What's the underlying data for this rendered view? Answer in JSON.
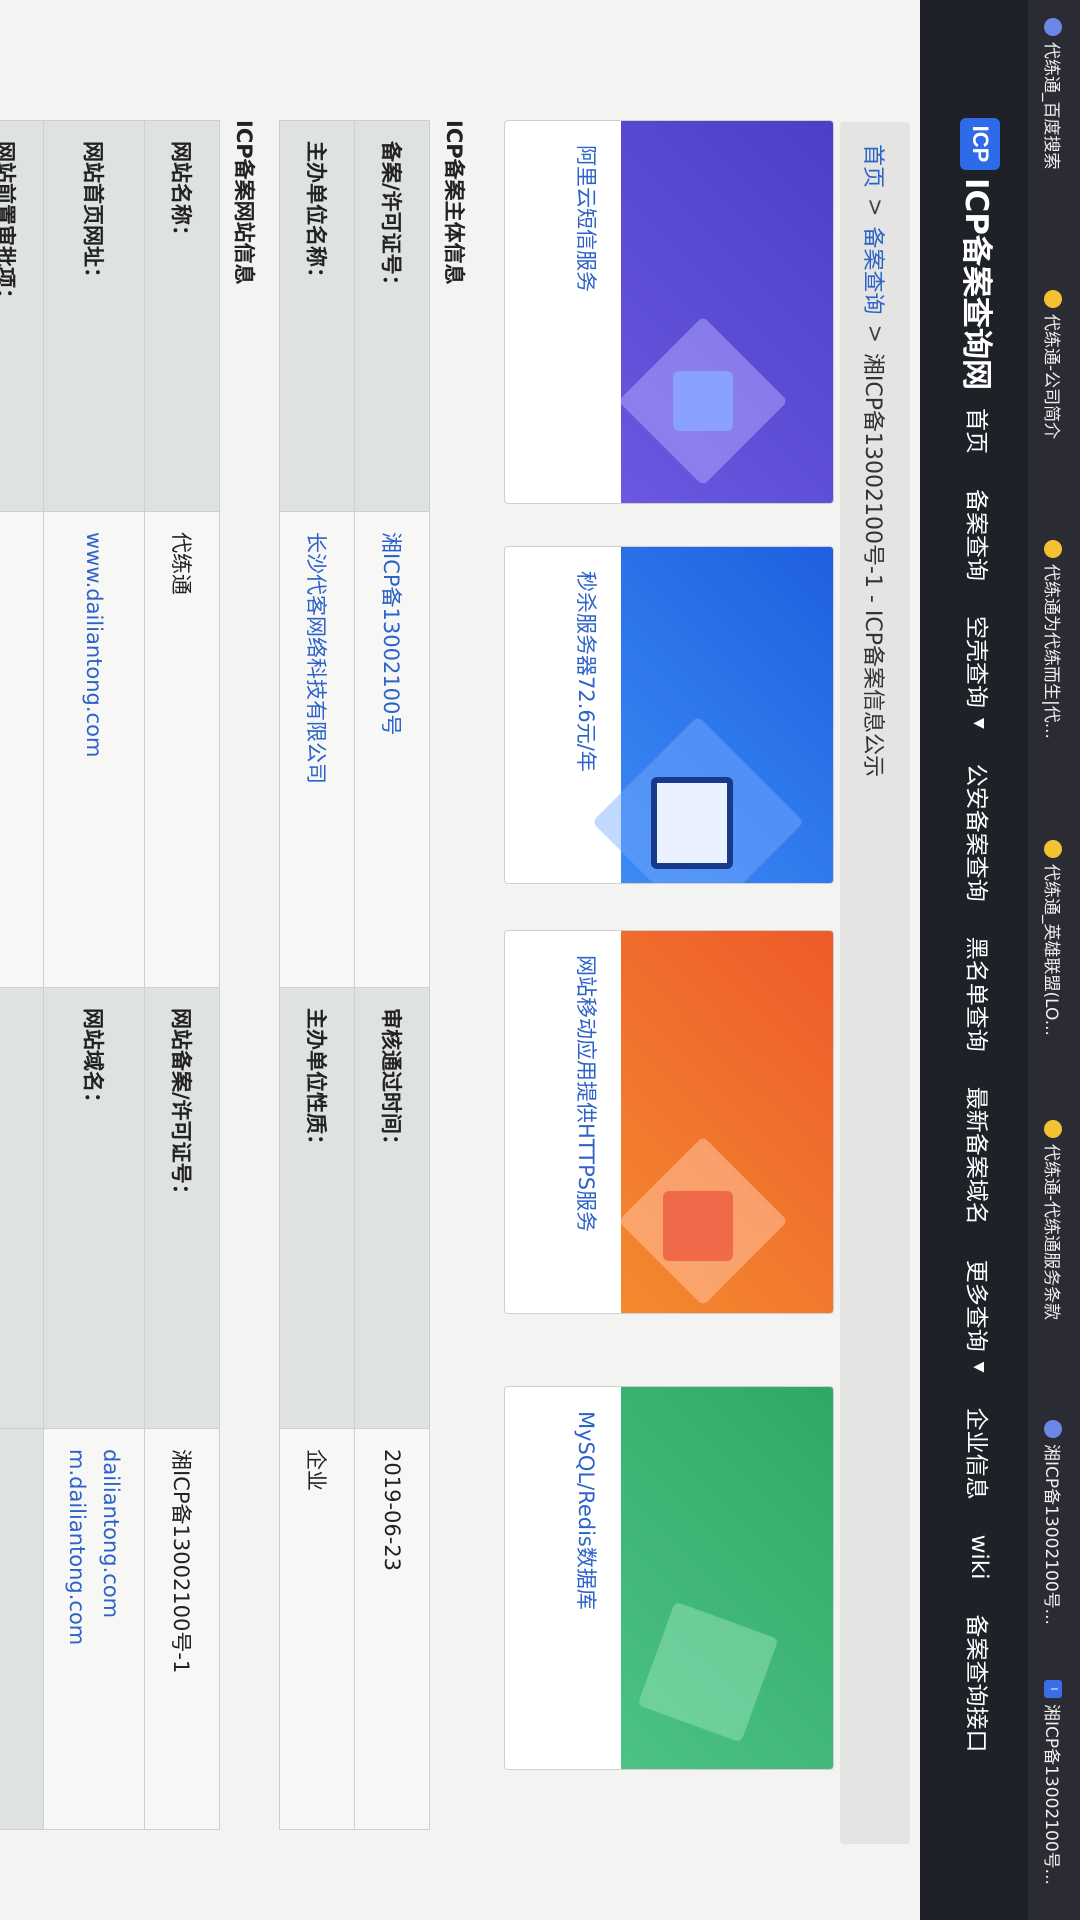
{
  "bookmarks": [
    {
      "label": "代练通_百度搜索",
      "icon": "paw-icon"
    },
    {
      "label": "代练通-公司简介",
      "icon": "paw-icon"
    },
    {
      "label": "代练通为代练而生|代...",
      "icon": "paw-icon"
    },
    {
      "label": "代练通_英雄联盟(LO...",
      "icon": "paw-icon"
    },
    {
      "label": "代练通-代练通服务条款",
      "icon": "paw-icon"
    },
    {
      "label": "湘ICP备13002100号...",
      "icon": "paw-icon"
    },
    {
      "label": "湘ICP备13002100号...",
      "icon": "icp-tab-icon"
    }
  ],
  "header": {
    "logo_text": "ICP",
    "site_title": "ICP备案查询网",
    "nav": [
      {
        "label": "首页",
        "dropdown": false
      },
      {
        "label": "备案查询",
        "dropdown": false
      },
      {
        "label": "空壳查询",
        "dropdown": true
      },
      {
        "label": "公安备案查询",
        "dropdown": false
      },
      {
        "label": "黑名单查询",
        "dropdown": false
      },
      {
        "label": "最新备案域名",
        "dropdown": false
      },
      {
        "label": "更多查询",
        "dropdown": true
      },
      {
        "label": "企业信息",
        "dropdown": false
      },
      {
        "label": "wiki",
        "dropdown": false
      },
      {
        "label": "备案查询接口",
        "dropdown": false
      }
    ]
  },
  "breadcrumb": {
    "home": "首页",
    "query": "备案查询",
    "current": "湘ICP备13002100号-1 - ICP备案信息公示"
  },
  "ads": [
    {
      "label": "阿里云短信服务",
      "color": "#5a4ad0"
    },
    {
      "label": "秒杀服务器72.6元/年",
      "color": "#2f6fe6"
    },
    {
      "label": "网站移动应用提供HTTPS服务",
      "color": "#f07a2c"
    },
    {
      "label": "MySQL/Redis数据库",
      "color": "#3bb070"
    }
  ],
  "entity_section": {
    "title": "ICP备案主体信息",
    "rows": [
      {
        "label1": "备案/许可证号：",
        "value1": "湘ICP备13002100号",
        "label2": "审核通过时间：",
        "value2": "2019-06-23"
      },
      {
        "label1": "主办单位名称：",
        "value1": "长沙代客网络科技有限公司",
        "label2": "主办单位性质：",
        "value2": "企业"
      }
    ]
  },
  "site_section": {
    "title": "ICP备案网站信息",
    "rows": [
      {
        "label1": "网站名称：",
        "value1": "代练通",
        "label2": "网站备案/许可证号：",
        "value2": "湘ICP备13002100号-1"
      },
      {
        "label1": "网站首页网址：",
        "value1": "www.dailiantong.com",
        "label2": "网站域名：",
        "value2a": "dailiantong.com",
        "value2b": "m.dailiantong.com"
      },
      {
        "label1": "网站前置审批项：",
        "value1": "",
        "label2": "",
        "value2": ""
      }
    ]
  }
}
